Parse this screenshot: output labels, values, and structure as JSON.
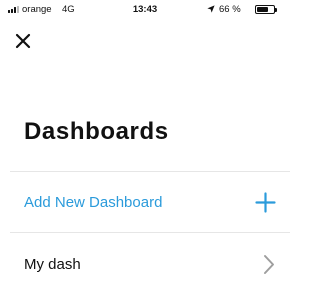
{
  "status_bar": {
    "carrier": "orange",
    "network": "4G",
    "time": "13:43",
    "signal_bars_active": 3,
    "signal_bars_total": 4,
    "battery_percent": "66 %",
    "battery_level": 0.66
  },
  "header": {
    "close_icon": "close-icon",
    "title": "Dashboards"
  },
  "list": {
    "add_item": {
      "label": "Add New Dashboard",
      "icon": "plus-icon",
      "color": "#2b9bdb"
    },
    "items": [
      {
        "label": "My dash",
        "icon": "chevron-right-icon"
      }
    ]
  }
}
